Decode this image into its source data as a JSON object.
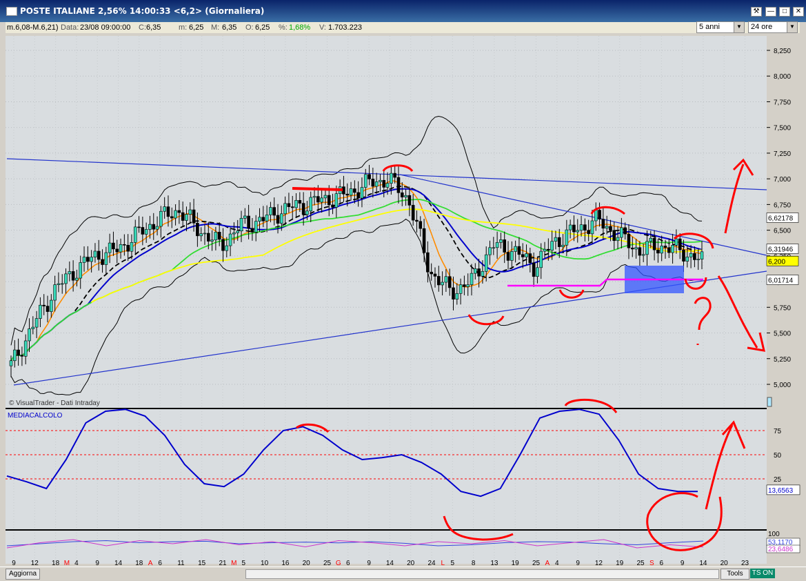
{
  "window": {
    "title": "POSTE ITALIANE 2,56% 14:00:33  <6,2> (Giornaliera)"
  },
  "infobar": {
    "range": "m.6,08-M.6,21)",
    "data_label": "Data:",
    "data_value": "23/08 09:00:00",
    "c_label": "C:",
    "c_value": "6,35",
    "m_label": "m:",
    "m_value": "6,25",
    "M_label": "M:",
    "M_value": "6,35",
    "o_label": "O:",
    "o_value": "6,25",
    "pct_label": "%:",
    "pct_value": "1,68%",
    "v_label": "V:",
    "v_value": "1.703.223"
  },
  "selectors": {
    "period": "5 anni",
    "interval": "24 ore"
  },
  "footer": {
    "aggiorna": "Aggiorna",
    "tools": "Tools",
    "tson": "TS ON"
  },
  "colors": {
    "background": "#d9dde0",
    "candle_up": "#38d8b8",
    "candle_down": "#000000",
    "ma_black": "#000000",
    "ma_orange": "#ff8c00",
    "ma_blue": "#0000cc",
    "ma_green": "#33dd33",
    "ma_yellow": "#ffff00",
    "support_magenta": "#ff00ff",
    "annotation_red": "#ff0000",
    "oscillator": "#0000cc",
    "box_blue": "#3355ff"
  },
  "chart_data": [
    {
      "type": "candlestick",
      "watermark": "© VisualTrader - Dati Intraday",
      "ylim": [
        4.85,
        8.35
      ],
      "y_ticks": [
        "8,250",
        "8,000",
        "7,750",
        "7,500",
        "7,250",
        "7,000",
        "6,750",
        "6,500",
        "6,250",
        "6,000",
        "5,750",
        "5,500",
        "5,250",
        "5,000"
      ],
      "y_tick_values": [
        8.25,
        8.0,
        7.75,
        7.5,
        7.25,
        7.0,
        6.75,
        6.5,
        6.25,
        6.0,
        5.75,
        5.5,
        5.25,
        5.0
      ],
      "price_labels": [
        {
          "text": "6,62178",
          "value": 6.62178
        },
        {
          "text": "6,31946",
          "value": 6.31946
        },
        {
          "text": "6,200",
          "value": 6.2,
          "highlight": true
        },
        {
          "text": "6,01714",
          "value": 6.01714
        }
      ],
      "x_month_labels": [
        "M",
        "A",
        "M",
        "G",
        "L",
        "A",
        "S"
      ],
      "x_day_labels": [
        "9",
        "12",
        "18",
        "4",
        "9",
        "14",
        "18",
        "6",
        "11",
        "15",
        "21",
        "5",
        "10",
        "16",
        "20",
        "25",
        "6",
        "9",
        "14",
        "20",
        "24",
        "5",
        "8",
        "13",
        "19",
        "25",
        "4",
        "9",
        "12",
        "19",
        "25",
        "6",
        "9",
        "14",
        "20",
        "23"
      ],
      "x_red_labels": [
        "M",
        "A",
        "M",
        "G",
        "L",
        "A",
        "S"
      ],
      "series": [
        {
          "name": "close",
          "values": [
            5.18,
            5.55,
            5.9,
            6.1,
            6.25,
            6.3,
            6.45,
            6.6,
            6.7,
            6.5,
            6.35,
            6.55,
            6.6,
            6.7,
            6.75,
            6.8,
            6.85,
            6.95,
            7.0,
            6.8,
            6.1,
            5.9,
            6.0,
            6.35,
            6.3,
            6.15,
            6.4,
            6.5,
            6.6,
            6.45,
            6.3,
            6.35,
            6.3,
            6.2
          ]
        }
      ]
    },
    {
      "type": "line",
      "title": "MEDIACALCOLO",
      "ylim": [
        0,
        100
      ],
      "y_ticks": [
        "75",
        "50",
        "25"
      ],
      "y_tick_values": [
        75,
        50,
        25
      ],
      "reference_lines": [
        75,
        50,
        25
      ],
      "last_value_label": "13,6563",
      "series": [
        {
          "name": "MEDIACALCOLO",
          "values": [
            28,
            22,
            15,
            45,
            83,
            95,
            97,
            90,
            70,
            40,
            20,
            17,
            30,
            55,
            75,
            79,
            70,
            55,
            45,
            47,
            50,
            42,
            30,
            12,
            7,
            15,
            50,
            88,
            95,
            97,
            92,
            65,
            30,
            15,
            12,
            12
          ]
        }
      ]
    },
    {
      "type": "line",
      "y_tick": "100",
      "last_value_labels": [
        "53,1170",
        "23,6486"
      ],
      "series": [
        {
          "name": "blue",
          "values": [
            30,
            40,
            50,
            55,
            45,
            50,
            52,
            40,
            45,
            48,
            44,
            50,
            42,
            30,
            35,
            45,
            50,
            48,
            40,
            35,
            45,
            53
          ]
        },
        {
          "name": "magenta",
          "values": [
            20,
            45,
            60,
            30,
            55,
            40,
            60,
            35,
            50,
            25,
            55,
            45,
            30,
            50,
            40,
            55,
            30,
            45,
            60,
            20,
            35,
            24
          ]
        }
      ]
    }
  ]
}
